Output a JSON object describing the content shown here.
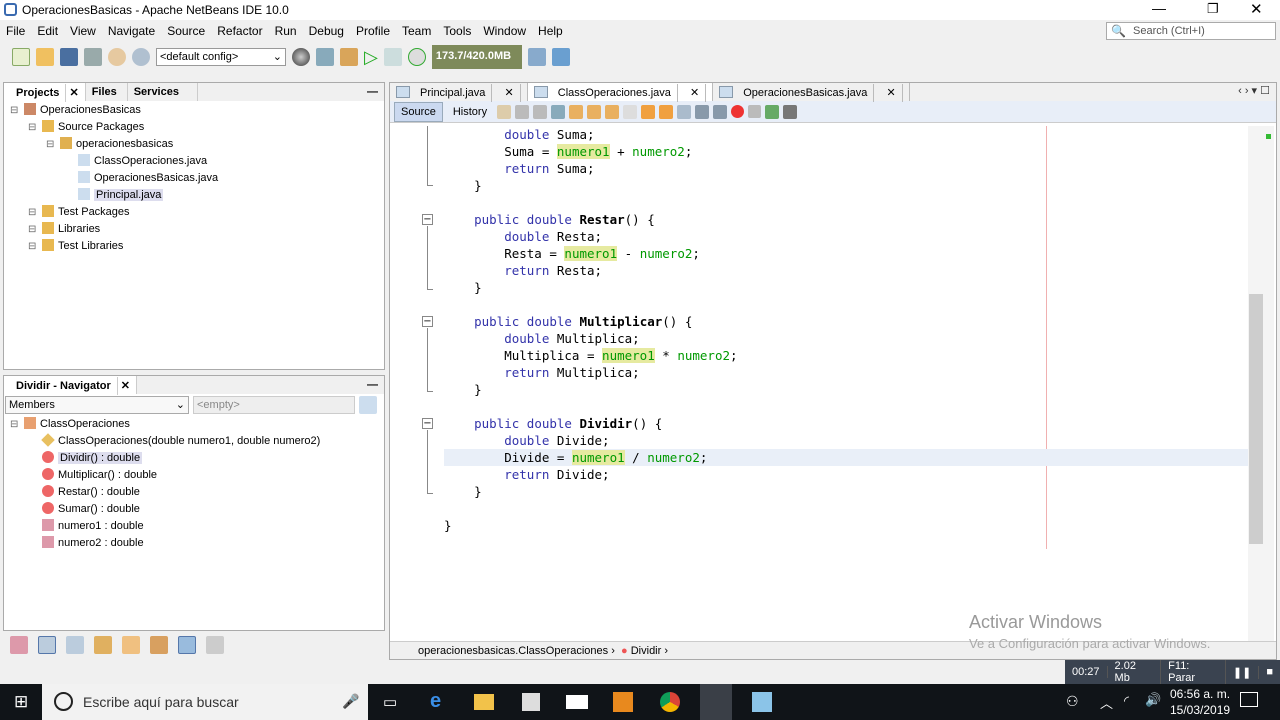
{
  "window": {
    "title": "OperacionesBasicas - Apache NetBeans IDE 10.0"
  },
  "menu": [
    "File",
    "Edit",
    "View",
    "Navigate",
    "Source",
    "Refactor",
    "Run",
    "Debug",
    "Profile",
    "Team",
    "Tools",
    "Window",
    "Help"
  ],
  "search": {
    "placeholder": "Search (Ctrl+I)"
  },
  "toolbar": {
    "config": "<default config>",
    "memory": "173.7/420.0MB"
  },
  "projects": {
    "tabs": [
      "Projects",
      "Files",
      "Services"
    ],
    "tree": [
      {
        "label": "OperacionesBasicas",
        "level": 0,
        "icon": "project"
      },
      {
        "label": "Source Packages",
        "level": 1,
        "icon": "folder"
      },
      {
        "label": "operacionesbasicas",
        "level": 2,
        "icon": "package"
      },
      {
        "label": "ClassOperaciones.java",
        "level": 3,
        "icon": "java"
      },
      {
        "label": "OperacionesBasicas.java",
        "level": 3,
        "icon": "java"
      },
      {
        "label": "Principal.java",
        "level": 3,
        "icon": "java",
        "selected": true
      },
      {
        "label": "Test Packages",
        "level": 1,
        "icon": "folder"
      },
      {
        "label": "Libraries",
        "level": 1,
        "icon": "folder"
      },
      {
        "label": "Test Libraries",
        "level": 1,
        "icon": "folder"
      }
    ]
  },
  "navigator": {
    "title": "Dividir - Navigator",
    "filter": "Members",
    "empty": "<empty>",
    "tree": [
      {
        "label": "ClassOperaciones",
        "level": 0,
        "icon": "class"
      },
      {
        "label": "ClassOperaciones(double numero1, double numero2)",
        "level": 1,
        "icon": "constructor"
      },
      {
        "label": "Dividir() : double",
        "level": 1,
        "icon": "method",
        "selected": true
      },
      {
        "label": "Multiplicar() : double",
        "level": 1,
        "icon": "method"
      },
      {
        "label": "Restar() : double",
        "level": 1,
        "icon": "method"
      },
      {
        "label": "Sumar() : double",
        "level": 1,
        "icon": "method"
      },
      {
        "label": "numero1 : double",
        "level": 1,
        "icon": "field"
      },
      {
        "label": "numero2 : double",
        "level": 1,
        "icon": "field"
      }
    ]
  },
  "editor": {
    "tabs": [
      "Principal.java",
      "ClassOperaciones.java",
      "OperacionesBasicas.java"
    ],
    "active_tab": 1,
    "source": "Source",
    "history": "History",
    "code": [
      [
        [
          "        "
        ],
        [
          "double",
          "kw"
        ],
        [
          " Suma;"
        ]
      ],
      [
        [
          "        Suma = "
        ],
        [
          "numero1",
          "hl"
        ],
        [
          " + "
        ],
        [
          "numero2",
          "fld"
        ],
        [
          ";"
        ]
      ],
      [
        [
          "        "
        ],
        [
          "return",
          "kw"
        ],
        [
          " Suma;"
        ]
      ],
      [
        [
          "    }"
        ]
      ],
      [
        [
          ""
        ]
      ],
      [
        [
          "    "
        ],
        [
          "public",
          "kw"
        ],
        [
          " "
        ],
        [
          "double",
          "kw"
        ],
        [
          " "
        ],
        [
          "Restar",
          "mb"
        ],
        [
          "() {"
        ]
      ],
      [
        [
          "        "
        ],
        [
          "double",
          "kw"
        ],
        [
          " Resta;"
        ]
      ],
      [
        [
          "        Resta = "
        ],
        [
          "numero1",
          "hl"
        ],
        [
          " - "
        ],
        [
          "numero2",
          "fld"
        ],
        [
          ";"
        ]
      ],
      [
        [
          "        "
        ],
        [
          "return",
          "kw"
        ],
        [
          " Resta;"
        ]
      ],
      [
        [
          "    }"
        ]
      ],
      [
        [
          ""
        ]
      ],
      [
        [
          "    "
        ],
        [
          "public",
          "kw"
        ],
        [
          " "
        ],
        [
          "double",
          "kw"
        ],
        [
          " "
        ],
        [
          "Multiplicar",
          "mb"
        ],
        [
          "() {"
        ]
      ],
      [
        [
          "        "
        ],
        [
          "double",
          "kw"
        ],
        [
          " Multiplica;"
        ]
      ],
      [
        [
          "        Multiplica = "
        ],
        [
          "numero1",
          "hl"
        ],
        [
          " * "
        ],
        [
          "numero2",
          "fld"
        ],
        [
          ";"
        ]
      ],
      [
        [
          "        "
        ],
        [
          "return",
          "kw"
        ],
        [
          " Multiplica;"
        ]
      ],
      [
        [
          "    }"
        ]
      ],
      [
        [
          ""
        ]
      ],
      [
        [
          "    "
        ],
        [
          "public",
          "kw"
        ],
        [
          " "
        ],
        [
          "double",
          "kw"
        ],
        [
          " "
        ],
        [
          "Dividir",
          "mb"
        ],
        [
          "() {"
        ]
      ],
      [
        [
          "        "
        ],
        [
          "double",
          "kw"
        ],
        [
          " Divide;"
        ]
      ],
      [
        [
          "        Divide = "
        ],
        [
          "numero1",
          "hl"
        ],
        [
          " / "
        ],
        [
          "numero2",
          "fld"
        ],
        [
          ";"
        ]
      ],
      [
        [
          "        "
        ],
        [
          "return",
          "kw"
        ],
        [
          " Divide;"
        ]
      ],
      [
        [
          "    }"
        ]
      ],
      [
        [
          ""
        ]
      ],
      [
        [
          "}"
        ]
      ]
    ],
    "current_line": 19,
    "breadcrumb": [
      "operacionesbasicas.ClassOperaciones",
      "Dividir"
    ]
  },
  "watermark": {
    "title": "Activar Windows",
    "subtitle": "Ve a Configuración para activar Windows."
  },
  "recorder": {
    "time": "00:27",
    "size": "2.02 Mb",
    "stop": "F11: Parar"
  },
  "taskbar": {
    "search": "Escribe aquí para buscar",
    "time": "06:56 a. m.",
    "date": "15/03/2019"
  }
}
